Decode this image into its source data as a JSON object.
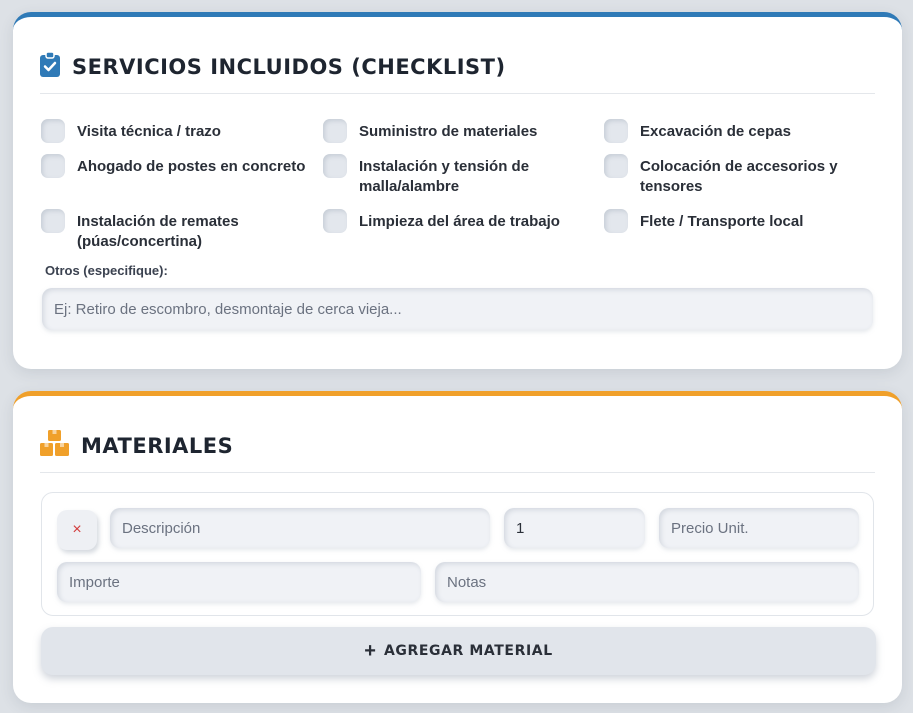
{
  "colors": {
    "services_accent": "#2f7ab7",
    "materials_accent": "#f0a02a",
    "remove_icon": "#d23b3b"
  },
  "services": {
    "icon": "clipboard-check-icon",
    "title": "SERVICIOS INCLUIDOS (CHECKLIST)",
    "items": [
      {
        "label": "Visita técnica / trazo",
        "checked": false
      },
      {
        "label": "Suministro de materiales",
        "checked": false
      },
      {
        "label": "Excavación de cepas",
        "checked": false
      },
      {
        "label": "Ahogado de postes en concreto",
        "checked": false
      },
      {
        "label": "Instalación y tensión de malla/alambre",
        "checked": false
      },
      {
        "label": "Colocación de accesorios y tensores",
        "checked": false
      },
      {
        "label": "Instalación de remates (púas/concertina)",
        "checked": false
      },
      {
        "label": "Limpieza del área de trabajo",
        "checked": false
      },
      {
        "label": "Flete / Transporte local",
        "checked": false
      }
    ],
    "others_label": "Otros (especifique):",
    "others_placeholder": "Ej: Retiro de escombro, desmontaje de cerca vieja...",
    "others_value": ""
  },
  "materials": {
    "icon": "boxes-icon",
    "title": "MATERIALES",
    "row": {
      "remove_symbol": "×",
      "description_placeholder": "Descripción",
      "quantity_value": "1",
      "price_placeholder": "Precio Unit.",
      "import_placeholder": "Importe",
      "notes_placeholder": "Notas"
    },
    "add_symbol": "+",
    "add_label": "AGREGAR MATERIAL"
  }
}
